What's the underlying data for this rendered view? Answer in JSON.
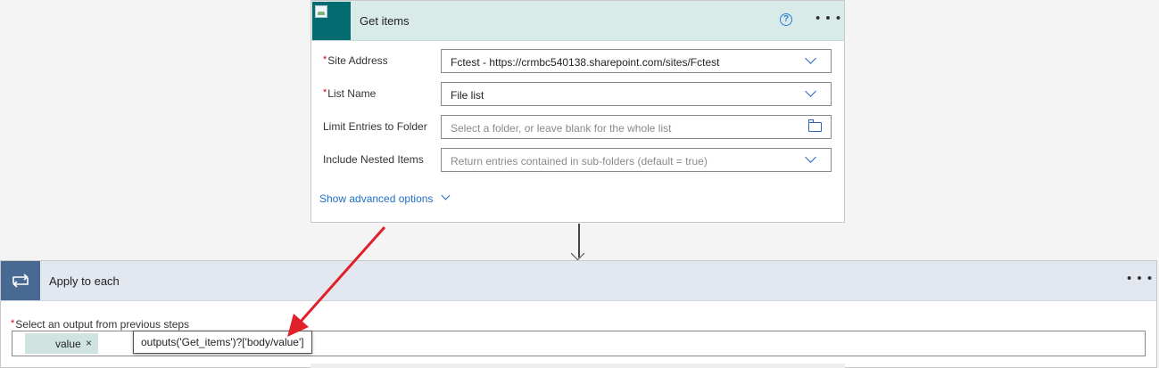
{
  "get_items": {
    "title": "Get items",
    "help_icon": "question-circle-icon",
    "more_icon": "ellipsis-icon",
    "fields": [
      {
        "label": "Site Address",
        "required": "*",
        "value": "Fctest - https://crmbc540138.sharepoint.com/sites/Fctest",
        "control": "dropdown"
      },
      {
        "label": "List Name",
        "required": "*",
        "value": "File list",
        "control": "dropdown"
      },
      {
        "label": "Limit Entries to Folder",
        "placeholder": "Select a folder, or leave blank for the whole list",
        "control": "folder-picker"
      },
      {
        "label": "Include Nested Items",
        "placeholder": "Return entries contained in sub-folders (default = true)",
        "control": "dropdown"
      }
    ],
    "advanced_link": "Show advanced options"
  },
  "apply_to_each": {
    "title": "Apply to each",
    "more_icon": "ellipsis-icon",
    "output_label": "Select an output from previous steps",
    "required": "*",
    "token": {
      "label": "value",
      "remove": "×"
    },
    "expression": "outputs('Get_items')?['body/value']"
  },
  "colors": {
    "sharepoint_teal": "#036c70",
    "card_header": "#d9ebe9",
    "loop_blue": "#486991",
    "link_blue": "#1f6ec6",
    "annotation_red": "#e0202a"
  }
}
